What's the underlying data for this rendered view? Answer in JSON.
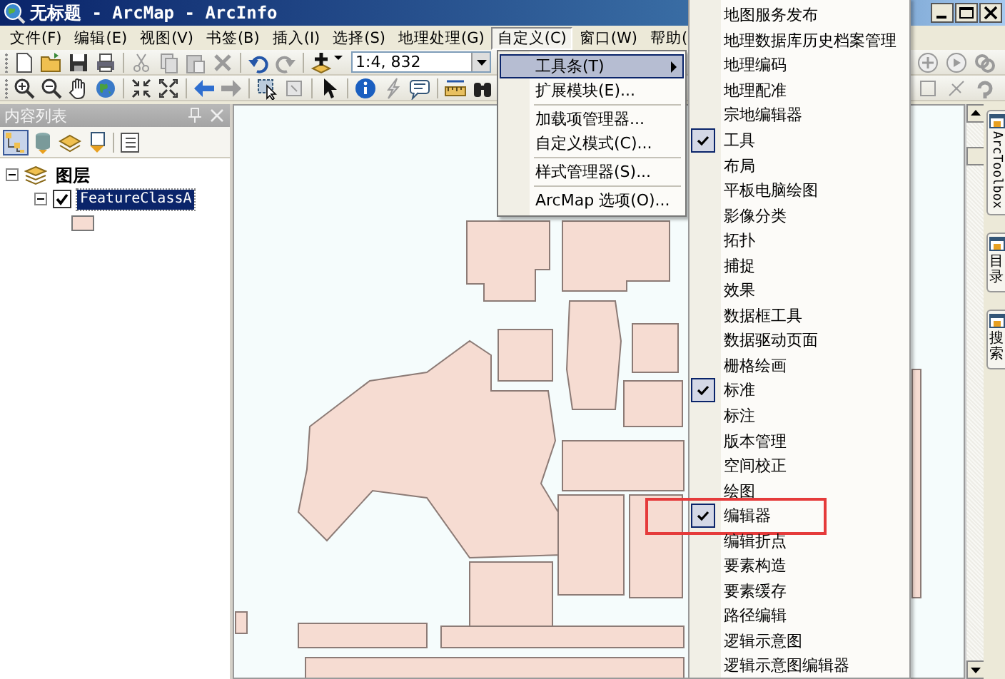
{
  "window": {
    "title": "无标题 - ArcMap - ArcInfo"
  },
  "menu_bar": [
    {
      "label": "文件(F)",
      "selected": false
    },
    {
      "label": "编辑(E)",
      "selected": false
    },
    {
      "label": "视图(V)",
      "selected": false
    },
    {
      "label": "书签(B)",
      "selected": false
    },
    {
      "label": "插入(I)",
      "selected": false
    },
    {
      "label": "选择(S)",
      "selected": false
    },
    {
      "label": "地理处理(G)",
      "selected": false
    },
    {
      "label": "自定义(C)",
      "selected": true
    },
    {
      "label": "窗口(W)",
      "selected": false
    },
    {
      "label": "帮助(",
      "selected": false
    }
  ],
  "toolbar": {
    "scale": "1:4, 832"
  },
  "toc": {
    "title": "内容列表",
    "layers": [
      {
        "label": "图层",
        "expanded": true,
        "children": [
          {
            "label": "FeatureClassA",
            "checked": true,
            "selected": true,
            "expanded": true
          }
        ]
      }
    ]
  },
  "menu": [
    {
      "kind": "item",
      "label": "工具条(T)",
      "selected": true,
      "submenu": true
    },
    {
      "kind": "item",
      "label": "扩展模块(E)...",
      "selected": false,
      "submenu": false
    },
    {
      "kind": "separator"
    },
    {
      "kind": "item",
      "label": "加载项管理器...",
      "selected": false,
      "submenu": false
    },
    {
      "kind": "item",
      "label": "自定义模式(C)...",
      "selected": false,
      "submenu": false
    },
    {
      "kind": "separator"
    },
    {
      "kind": "item",
      "label": "样式管理器(S)...",
      "selected": false,
      "submenu": false
    },
    {
      "kind": "separator"
    },
    {
      "kind": "item",
      "label": "ArcMap 选项(O)...",
      "selected": false,
      "submenu": false
    }
  ],
  "submenu": [
    {
      "label": "地图服务发布",
      "checked": false,
      "annotated": false
    },
    {
      "label": "地理数据库历史档案管理",
      "checked": false,
      "annotated": false
    },
    {
      "label": "地理编码",
      "checked": false,
      "annotated": false
    },
    {
      "label": "地理配准",
      "checked": false,
      "annotated": false
    },
    {
      "label": "宗地编辑器",
      "checked": false,
      "annotated": false
    },
    {
      "label": "工具",
      "checked": true,
      "annotated": false
    },
    {
      "label": "布局",
      "checked": false,
      "annotated": false
    },
    {
      "label": "平板电脑绘图",
      "checked": false,
      "annotated": false
    },
    {
      "label": "影像分类",
      "checked": false,
      "annotated": false
    },
    {
      "label": "拓扑",
      "checked": false,
      "annotated": false
    },
    {
      "label": "捕捉",
      "checked": false,
      "annotated": false
    },
    {
      "label": "效果",
      "checked": false,
      "annotated": false
    },
    {
      "label": "数据框工具",
      "checked": false,
      "annotated": false
    },
    {
      "label": "数据驱动页面",
      "checked": false,
      "annotated": false
    },
    {
      "label": "栅格绘画",
      "checked": false,
      "annotated": false
    },
    {
      "label": "标准",
      "checked": true,
      "annotated": false
    },
    {
      "label": "标注",
      "checked": false,
      "annotated": false
    },
    {
      "label": "版本管理",
      "checked": false,
      "annotated": false
    },
    {
      "label": "空间校正",
      "checked": false,
      "annotated": false
    },
    {
      "label": "绘图",
      "checked": false,
      "annotated": false
    },
    {
      "label": "编辑器",
      "checked": true,
      "annotated": true
    },
    {
      "label": "编辑折点",
      "checked": false,
      "annotated": false
    },
    {
      "label": "要素构造",
      "checked": false,
      "annotated": false
    },
    {
      "label": "要素缓存",
      "checked": false,
      "annotated": false
    },
    {
      "label": "路径编辑",
      "checked": false,
      "annotated": false
    },
    {
      "label": "逻辑示意图",
      "checked": false,
      "annotated": false
    },
    {
      "label": "逻辑示意图编辑器",
      "checked": false,
      "annotated": false
    }
  ],
  "dock_tabs": [
    {
      "label": "ArcToolbox",
      "kind": "latin"
    },
    {
      "label": "目录",
      "kind": "cjk"
    },
    {
      "label": "搜索",
      "kind": "cjk"
    }
  ]
}
